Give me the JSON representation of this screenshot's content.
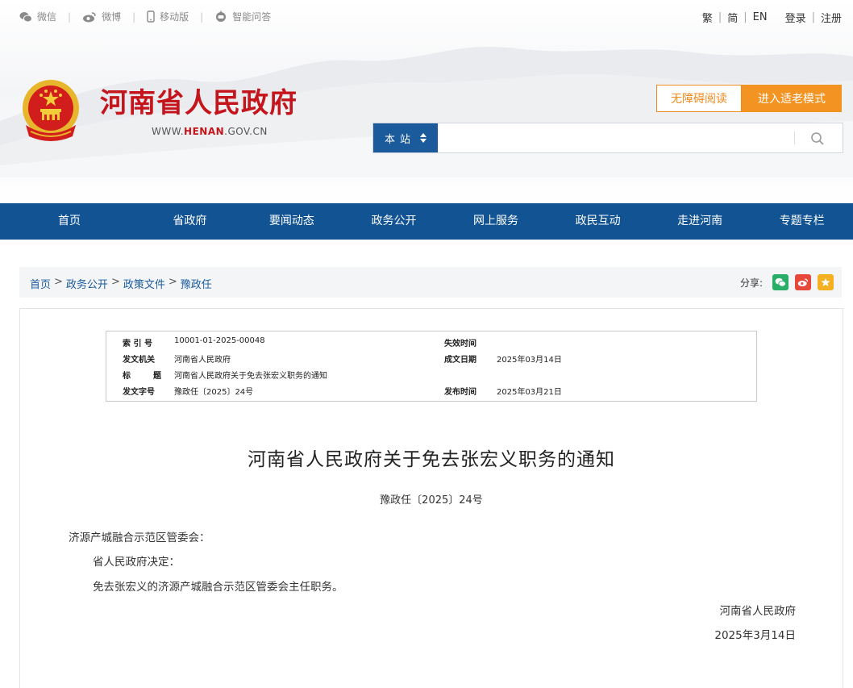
{
  "topbar": {
    "links": [
      {
        "label": "微信",
        "icon": "wechat-icon"
      },
      {
        "label": "微博",
        "icon": "weibo-icon"
      },
      {
        "label": "移动版",
        "icon": "mobile-icon"
      },
      {
        "label": "智能问答",
        "icon": "chat-bot-icon"
      }
    ],
    "lang_traditional": "繁",
    "lang_simplified": "简",
    "lang_english": "EN",
    "login": "登录",
    "register": "注册"
  },
  "header": {
    "site_title": "河南省人民政府",
    "url_prefix": "WWW.",
    "url_brand": "HENAN",
    "url_suffix": ".GOV.CN",
    "accessibility_button": "无障碍阅读",
    "elder_mode_button": "进入适老模式"
  },
  "search": {
    "scope": "本站",
    "placeholder": ""
  },
  "nav": {
    "items": [
      "首页",
      "省政府",
      "要闻动态",
      "政务公开",
      "网上服务",
      "政民互动",
      "走进河南",
      "专题专栏"
    ]
  },
  "breadcrumb": {
    "items": [
      "首页",
      "政务公开",
      "政策文件",
      "豫政任"
    ],
    "separator": ">",
    "share_label": "分享:"
  },
  "meta": {
    "index_label": "索 引 号",
    "index_value": "10001-01-2025-00048",
    "expire_label": "失效时间",
    "expire_value": "",
    "issuer_label": "发文机关",
    "issuer_value": "河南省人民政府",
    "written_label": "成文日期",
    "written_value": "2025年03月14日",
    "title_label_1": "标",
    "title_label_2": "题",
    "title_value": "河南省人民政府关于免去张宏义职务的通知",
    "docno_label": "发文字号",
    "docno_value": "豫政任〔2025〕24号",
    "publish_label": "发布时间",
    "publish_value": "2025年03月21日"
  },
  "document": {
    "title": "河南省人民政府关于免去张宏义职务的通知",
    "doc_number": "豫政任〔2025〕24号",
    "addressee": "济源产城融合示范区管委会：",
    "paragraphs": [
      "省人民政府决定：",
      "免去张宏义的济源产城融合示范区管委会主任职务。"
    ],
    "signer": "河南省人民政府",
    "date": "2025年3月14日"
  },
  "colors": {
    "brand_red": "#c4151c",
    "nav_blue": "#125393",
    "accent_orange": "#f39321",
    "wechat_green": "#2aae67",
    "weibo_red": "#e6483c",
    "favorite_yellow": "#f5b021"
  }
}
